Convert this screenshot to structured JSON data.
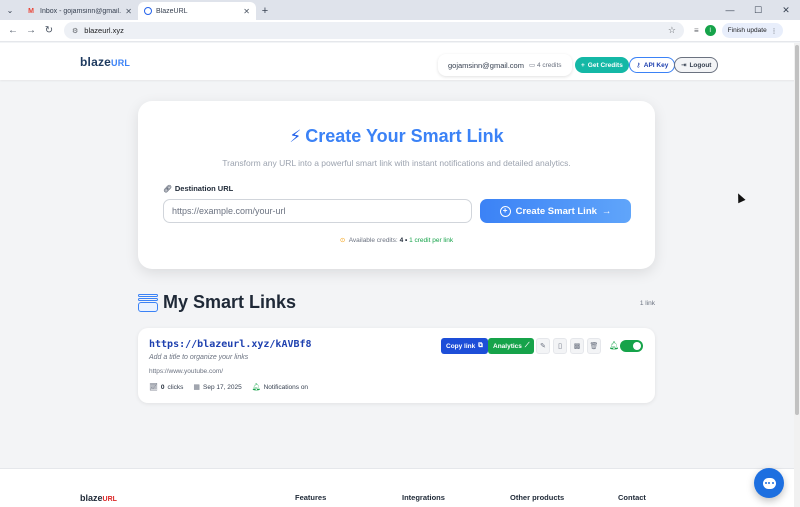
{
  "browser": {
    "tabs": [
      {
        "title": "Inbox - gojamsinn@gmail.com",
        "icon": "gmail-icon"
      },
      {
        "title": "BlazeURL",
        "icon": "blazeurl-icon"
      }
    ],
    "address": "blazeurl.xyz",
    "profile_initial": "I",
    "finish_update_label": "Finish update"
  },
  "header": {
    "logo_main": "blaze",
    "logo_accent": "URL",
    "email": "gojamsinn@gmail.com",
    "credits": "4 credits",
    "get_credits_label": "Get Credits",
    "api_key_label": "API Key",
    "logout_label": "Logout"
  },
  "create": {
    "title": "Create Your Smart Link",
    "subtitle": "Transform any URL into a powerful smart link with instant notifications and detailed analytics.",
    "destination_label": "Destination URL",
    "destination_placeholder": "https://example.com/your-url",
    "button_label": "Create Smart Link",
    "available_prefix": "Available credits:",
    "available_count": "4",
    "separator": "•",
    "per_link": "1 credit per link"
  },
  "links": {
    "title": "My Smart Links",
    "count_label": "1 link",
    "items": [
      {
        "short_url": "https://blazeurl.xyz/kAVBf8",
        "title_placeholder": "Add a title to organize your links",
        "destination": "https://www.youtube.com/",
        "clicks": "0",
        "clicks_label": "clicks",
        "date": "Sep 17, 2025",
        "notifications": "Notifications on",
        "copy_label": "Copy link",
        "analytics_label": "Analytics",
        "enabled": true
      }
    ]
  },
  "footer": {
    "logo_main": "blaze",
    "logo_accent": "URL",
    "columns": [
      "Features",
      "Integrations",
      "Other products",
      "Contact"
    ]
  },
  "colors": {
    "accent": "#3b82f6",
    "success": "#16a34a",
    "teal": "#14b8a6",
    "link_blue": "#1e40af"
  }
}
